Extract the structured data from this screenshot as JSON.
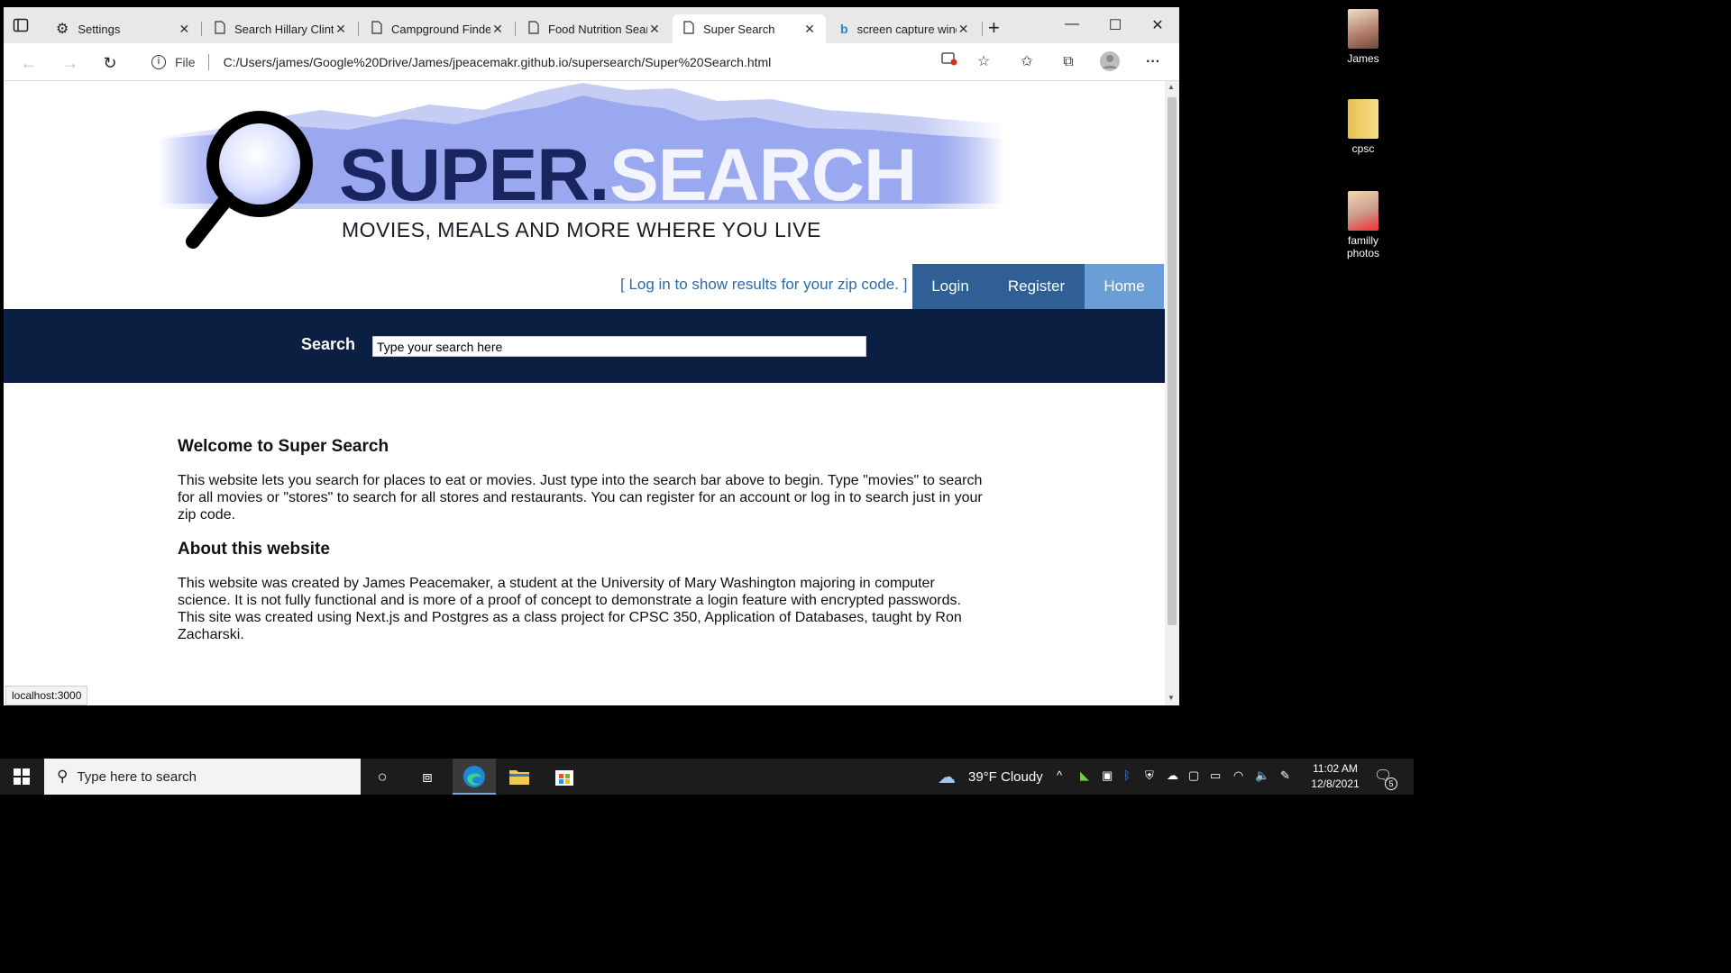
{
  "browser": {
    "tabs": [
      {
        "label": "Settings",
        "icon": "gear-icon"
      },
      {
        "label": "Search Hillary Clinton",
        "icon": "page-icon"
      },
      {
        "label": "Campground Finder",
        "icon": "page-icon"
      },
      {
        "label": "Food Nutrition Search",
        "icon": "page-icon"
      },
      {
        "label": "Super Search",
        "icon": "page-icon"
      },
      {
        "label": "screen capture window",
        "icon": "bing-icon"
      }
    ],
    "new_tab": "+",
    "address": {
      "scheme_label": "File",
      "url": "C:/Users/james/Google%20Drive/James/jpeacemakr.github.io/supersearch/Super%20Search.html"
    },
    "status_url": "localhost:3000"
  },
  "page": {
    "brand_super": "SUPER.",
    "brand_search": "SEARCH",
    "tagline": "MOVIES, MEALS AND MORE WHERE YOU LIVE",
    "login_message": "[ Log in to show results for your zip code. ]",
    "nav": [
      {
        "label": "Login",
        "color": "#2f5f94"
      },
      {
        "label": "Register",
        "color": "#2f5f94"
      },
      {
        "label": "Home",
        "color": "#6b9ed6"
      }
    ],
    "search": {
      "label": "Search",
      "value": "Type your search here"
    },
    "sections": [
      {
        "heading": "Welcome to Super Search",
        "body": "This website lets you search for places to eat or movies. Just type into the search bar above to begin. Type \"movies\" to search for all movies or \"stores\" to search for all stores and restaurants. You can register for an account or log in to search just in your zip code."
      },
      {
        "heading": "About this website",
        "body": "This website was created by James Peacemaker, a student at the University of Mary Washington majoring in computer science. It is not fully functional and is more of a proof of concept to demonstrate a login feature with encrypted passwords. This site was created using Next.js and Postgres as a class project for CPSC 350, Application of Databases, taught by Ron Zacharski."
      }
    ],
    "colors": {
      "search_band": "#0b1f43",
      "brand_dark": "#1a2560",
      "mountain": "#9aa8f0",
      "link": "#2d6aa8"
    }
  },
  "desktop": {
    "icons": [
      {
        "label": "James"
      },
      {
        "label": "cpsc"
      },
      {
        "label": "familly photos"
      }
    ]
  },
  "taskbar": {
    "search_placeholder": "Type here to search",
    "weather": "39°F  Cloudy",
    "time": "11:02 AM",
    "date": "12/8/2021",
    "notification_count": "5"
  }
}
